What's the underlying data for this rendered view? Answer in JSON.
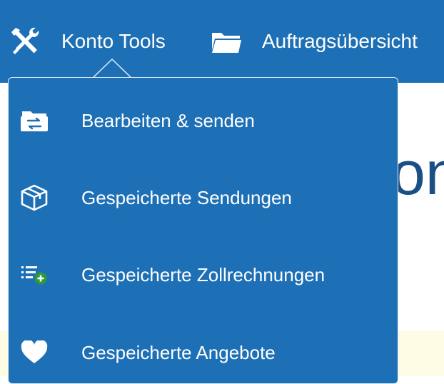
{
  "topnav": {
    "tools_label": "Konto Tools",
    "orders_label": "Auftragsübersicht"
  },
  "page": {
    "heading_fragment": "on"
  },
  "menu": {
    "items": [
      {
        "label": "Bearbeiten & senden",
        "icon": "edit-send-icon"
      },
      {
        "label": "Gespeicherte Sendungen",
        "icon": "box-icon"
      },
      {
        "label": "Gespeicherte Zollrechnungen",
        "icon": "list-add-icon"
      },
      {
        "label": "Gespeicherte Angebote",
        "icon": "heart-icon"
      }
    ]
  },
  "colors": {
    "brand_blue": "#1e70b6",
    "accent_green": "#2c9a3c",
    "heading_blue": "#1a4f86"
  }
}
